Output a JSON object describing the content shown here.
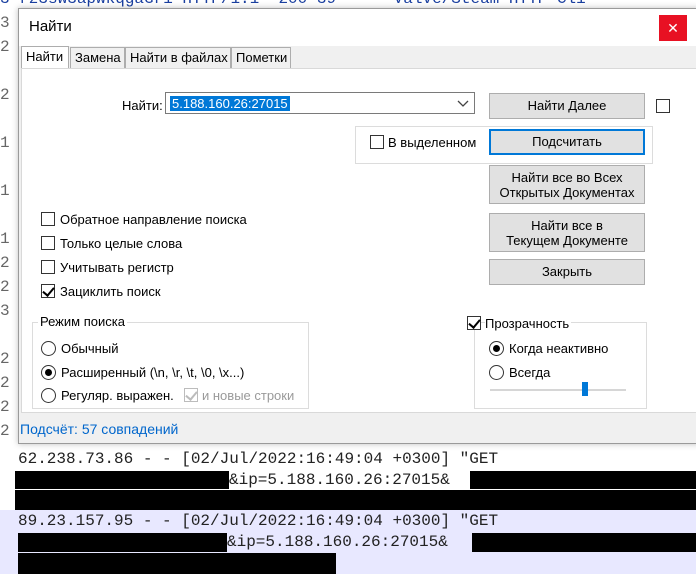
{
  "background": {
    "top_line": "3 rz3sw3apwkqgaGri HTTP/1.1\" 200 39 \"-\" \"Valve/Steam HTTP Cli",
    "log_line_1": "62.238.73.86 - - [02/Jul/2022:16:49:04 +0300] \"GET",
    "log_line_1b": "&ip=5.188.160.26:27015&",
    "log_line_2": "89.23.157.95 - - [02/Jul/2022:16:49:04 +0300] \"GET",
    "log_line_2b": "&ip=5.188.160.26:27015&",
    "gutter_chars": [
      "3",
      "2",
      "",
      "2",
      "",
      "1",
      "",
      "1",
      "",
      "1",
      "2",
      "2",
      "3",
      "",
      "2",
      "2",
      "2",
      "2"
    ],
    "right_chars": [
      "t",
      "",
      "K",
      "",
      "m",
      "",
      "X",
      "",
      "K",
      "",
      "X",
      "T",
      "X",
      "",
      "K"
    ]
  },
  "dialog": {
    "title": "Найти",
    "close_glyph": "✕",
    "tabs": [
      "Найти",
      "Замена",
      "Найти в файлах",
      "Пометки"
    ],
    "find_label": "Найти:",
    "find_value": "5.188.160.26:27015",
    "in_selection_label": "В выделенном",
    "options": [
      {
        "label": "Обратное направление поиска",
        "checked": false
      },
      {
        "label": "Только целые слова",
        "checked": false
      },
      {
        "label": "Учитывать регистр",
        "checked": false
      },
      {
        "label": "Зациклить поиск",
        "checked": true
      }
    ],
    "search_mode": {
      "title": "Режим поиска",
      "modes": [
        "Обычный",
        "Расширенный (\\n, \\r, \\t, \\0, \\x...)",
        "Регуляр. выражен."
      ],
      "selected": 1,
      "newline_label": "и новые строки"
    },
    "transparency": {
      "label": "Прозрачность",
      "checked": true,
      "modes": [
        "Когда неактивно",
        "Всегда"
      ],
      "selected": 0,
      "level": 0.7
    },
    "buttons": {
      "find_next": "Найти Далее",
      "count": "Подсчитать",
      "find_all_open_1": "Найти все во Всех",
      "find_all_open_2": "Открытых Документах",
      "find_all_current_1": "Найти все в",
      "find_all_current_2": "Текущем Документе",
      "close": "Закрыть"
    },
    "status": "Подсчёт: 57 совпадений"
  }
}
